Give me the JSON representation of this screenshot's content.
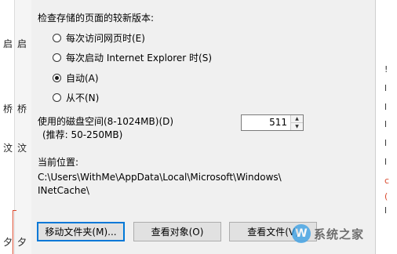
{
  "left_fragments": {
    "c1": "启",
    "c2": "启",
    "c3": "桥",
    "c4": "桥",
    "c5": "汶",
    "c6": "汶",
    "c7": "夕",
    "c8": "夕"
  },
  "right_fragments": {
    "c1": "!",
    "c2": "l",
    "c3": "l",
    "c4": "l",
    "c5": "l",
    "c6": "l",
    "c7": "c",
    "c8": "(",
    "c9": "l"
  },
  "dialog": {
    "check_label": "检查存储的页面的较新版本:",
    "radios": [
      {
        "label": "每次访问网页时(E)",
        "checked": false
      },
      {
        "label": "每次启动 Internet Explorer 时(S)",
        "checked": false
      },
      {
        "label": "自动(A)",
        "checked": true
      },
      {
        "label": "从不(N)",
        "checked": false
      }
    ],
    "disk_label": "使用的磁盘空间(8-1024MB)(D)",
    "disk_hint": "(推荐: 50-250MB)",
    "disk_value": "511",
    "location_label": "当前位置:",
    "location_path_1": "C:\\Users\\WithMe\\AppData\\Local\\Microsoft\\Windows\\",
    "location_path_2": "INetCache\\",
    "buttons": {
      "move": "移动文件夹(M)...",
      "view_objects": "查看对象(O)",
      "view_files": "查看文件(V)"
    }
  },
  "watermark": {
    "logo": "W",
    "text": "系统之家"
  }
}
